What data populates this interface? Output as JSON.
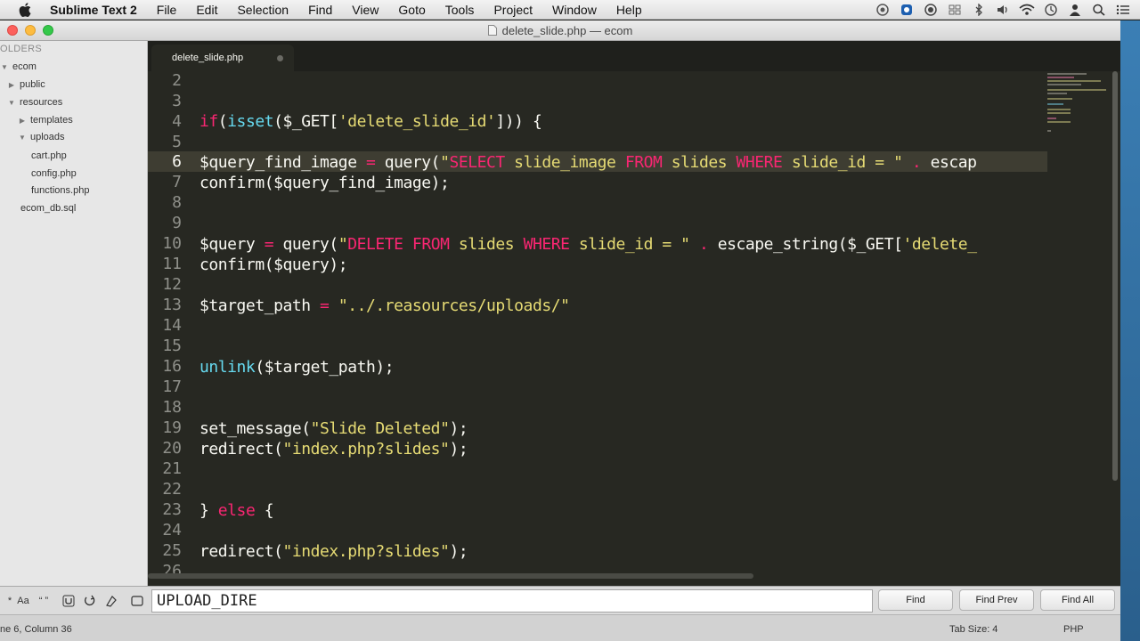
{
  "menubar": {
    "app_name": "Sublime Text 2",
    "items": [
      "File",
      "Edit",
      "Selection",
      "Find",
      "View",
      "Goto",
      "Tools",
      "Project",
      "Window",
      "Help"
    ]
  },
  "window": {
    "title": "delete_slide.php — ecom"
  },
  "sidebar": {
    "header": "OLDERS",
    "tree": [
      {
        "label": "ecom",
        "type": "folder-open"
      },
      {
        "label": "public",
        "type": "folder-closed"
      },
      {
        "label": "resources",
        "type": "folder-open"
      },
      {
        "label": "templates",
        "type": "folder-closed"
      },
      {
        "label": "uploads",
        "type": "folder-open"
      },
      {
        "label": "cart.php",
        "type": "file"
      },
      {
        "label": "config.php",
        "type": "file"
      },
      {
        "label": "functions.php",
        "type": "file"
      },
      {
        "label": "ecom_db.sql",
        "type": "file"
      }
    ]
  },
  "editor": {
    "tab_label": "delete_slide.php",
    "line_numbers": [
      "2",
      "3",
      "4",
      "5",
      "6",
      "7",
      "8",
      "9",
      "10",
      "11",
      "12",
      "13",
      "14",
      "15",
      "16",
      "17",
      "18",
      "19",
      "20",
      "21",
      "22",
      "23",
      "24",
      "25",
      "26"
    ],
    "current_line": "6"
  },
  "find_panel": {
    "input_value": "UPLOAD_DIRE",
    "find_label": "Find",
    "find_prev_label": "Find Prev",
    "find_all_label": "Find All",
    "case_option": "Aa",
    "whole_word_option": "“ ”"
  },
  "statusbar": {
    "position": "ne 6, Column 36",
    "tab_size": "Tab Size: 4",
    "syntax": "PHP"
  },
  "colors": {
    "editor_bg": "#272822",
    "keyword": "#f92672",
    "function": "#66d9ef",
    "string": "#e6db74",
    "text": "#f8f8f2"
  },
  "code_lines": {
    "l4": {
      "a": "if",
      "b": "(",
      "c": "isset",
      "d": "($_GET[",
      "e": "'delete_slide_id'",
      "f": "])) {"
    },
    "l6": {
      "a": "$query_find_image ",
      "b": "=",
      "c": " query(",
      "d": "\"",
      "e": "SELECT",
      "f": " slide_image ",
      "g": "FROM",
      "h": " slides ",
      "i": "WHERE",
      "j": " slide_id = \" ",
      "k": ".",
      "l": " escap"
    },
    "l7": {
      "a": "confirm($query_find_image);"
    },
    "l10": {
      "a": "$query ",
      "b": "=",
      "c": " query(",
      "d": "\"",
      "e": "DELETE FROM",
      "f": " slides ",
      "g": "WHERE",
      "h": " slide_id = \" ",
      "i": ".",
      "j": " escape_string($_GET[",
      "k": "'delete_"
    },
    "l11": {
      "a": "confirm($query);"
    },
    "l13": {
      "a": "$target_path ",
      "b": "=",
      "c": " ",
      "d": "\"../.reasources/uploads/\""
    },
    "l16": {
      "a": "unlink",
      "b": "($target_path);"
    },
    "l19": {
      "a": "set_message(",
      "b": "\"Slide Deleted\"",
      "c": ");"
    },
    "l20": {
      "a": "redirect(",
      "b": "\"index.php?slides\"",
      "c": ");"
    },
    "l23": {
      "a": "} ",
      "b": "else",
      "c": " {"
    },
    "l25": {
      "a": "redirect(",
      "b": "\"index.php?slides\"",
      "c": ");"
    }
  }
}
